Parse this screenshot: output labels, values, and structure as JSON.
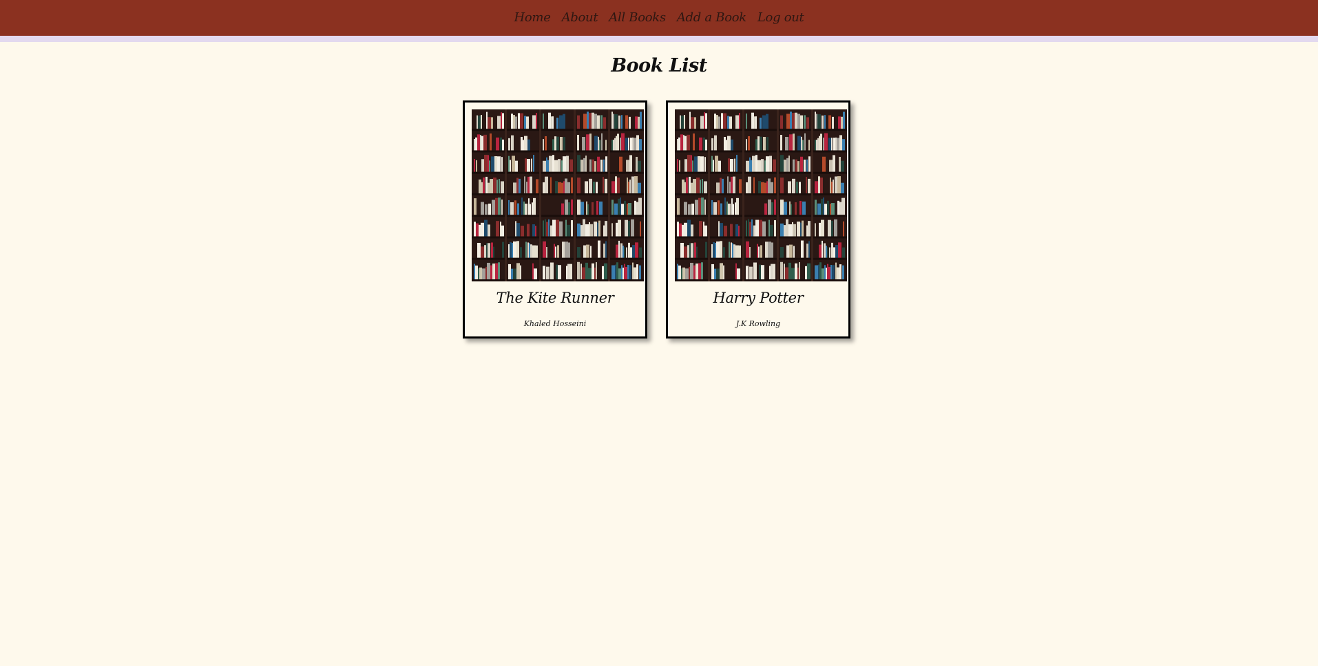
{
  "nav": {
    "items": [
      {
        "label": "Home"
      },
      {
        "label": "About"
      },
      {
        "label": "All Books"
      },
      {
        "label": "Add a Book"
      },
      {
        "label": "Log out"
      }
    ]
  },
  "page": {
    "title": "Book List"
  },
  "books": [
    {
      "title": "The Kite Runner",
      "author": "Khaled Hosseini",
      "cover_icon": "bookshelf-image"
    },
    {
      "title": "Harry Potter",
      "author": "J.K Rowling",
      "cover_icon": "bookshelf-image"
    }
  ],
  "colors": {
    "header": "#8b3120",
    "header_border": "#e3d9ef",
    "background": "#fef9ec",
    "shelf_dark": "#2a1814"
  }
}
